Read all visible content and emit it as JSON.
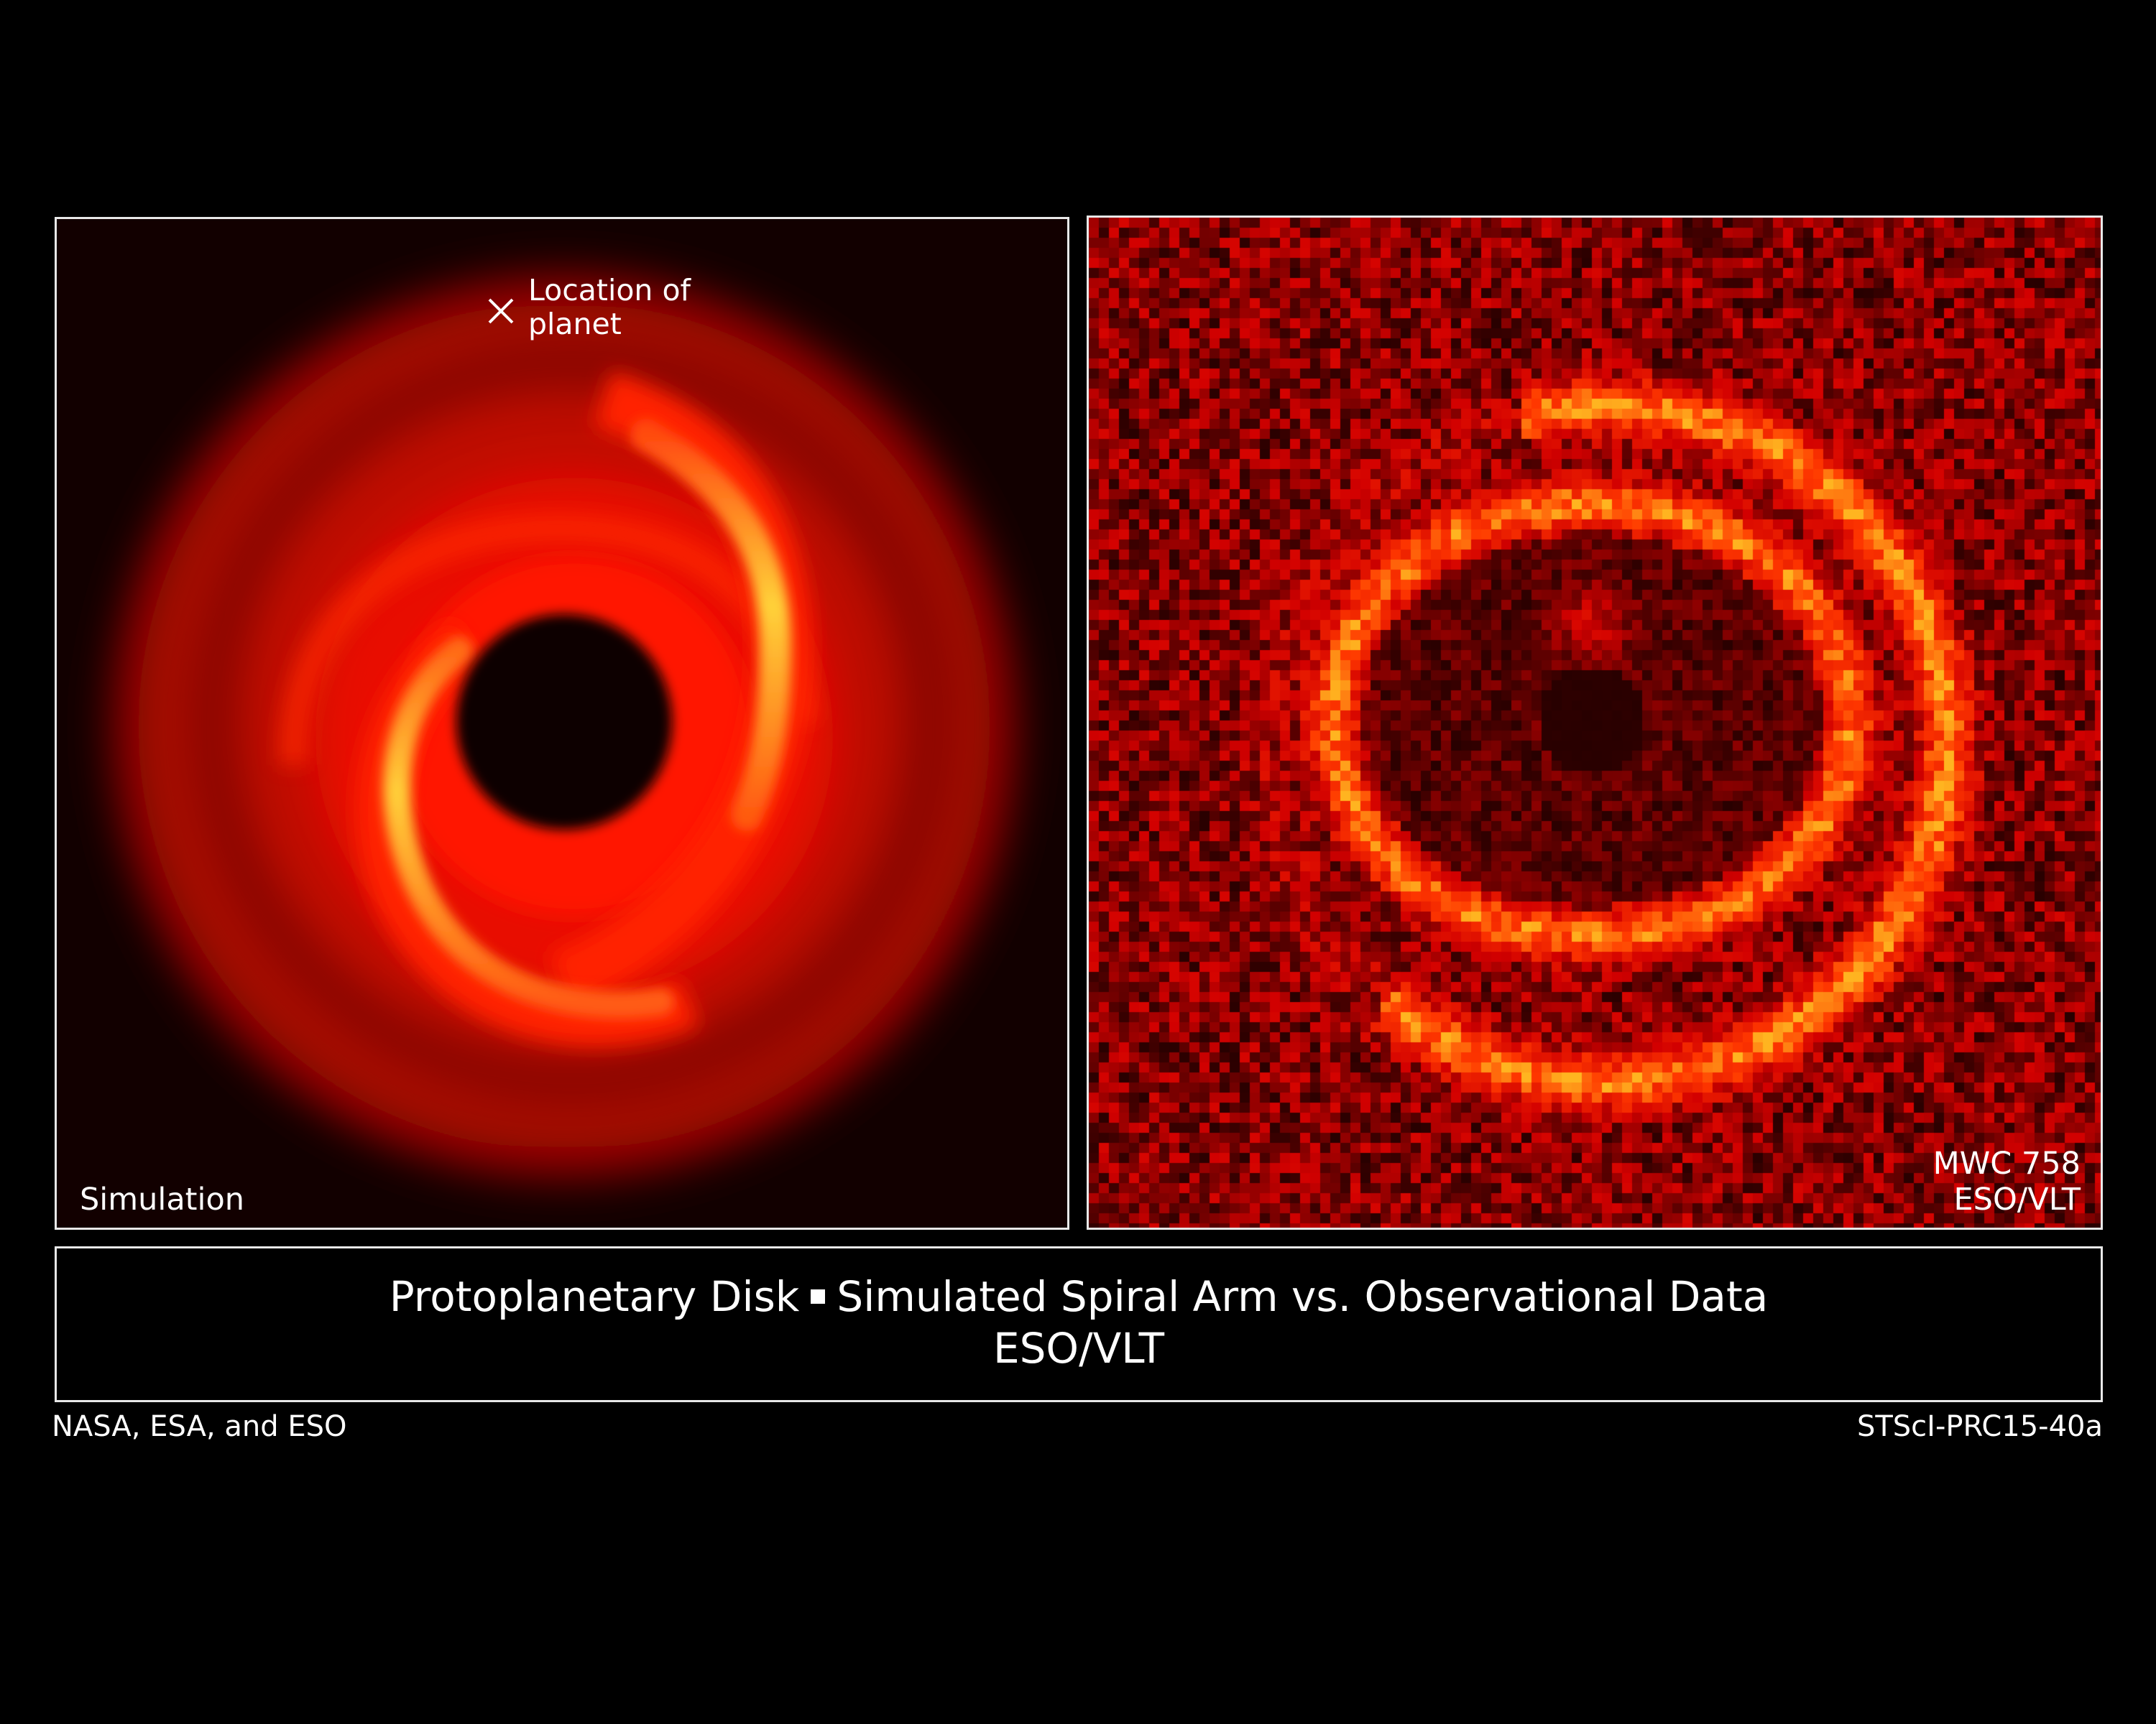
{
  "simulation_panel": {
    "label": "Simulation",
    "planet_annotation": {
      "line1": "Location of",
      "line2": "planet"
    }
  },
  "observation_panel": {
    "target": "MWC 758",
    "credit": "ESO/VLT"
  },
  "caption": {
    "title_left": "Protoplanetary Disk",
    "title_right": "Simulated Spiral Arm vs. Observational Data",
    "subtitle": "ESO/VLT"
  },
  "credits": {
    "left": "NASA, ESA, and ESO",
    "right": "STScI-PRC15-40a"
  },
  "colors": {
    "background": "#000000",
    "frame": "#e8e8e8",
    "disk_red": "#ff1a00",
    "arm_yellow": "#ffd23a"
  }
}
